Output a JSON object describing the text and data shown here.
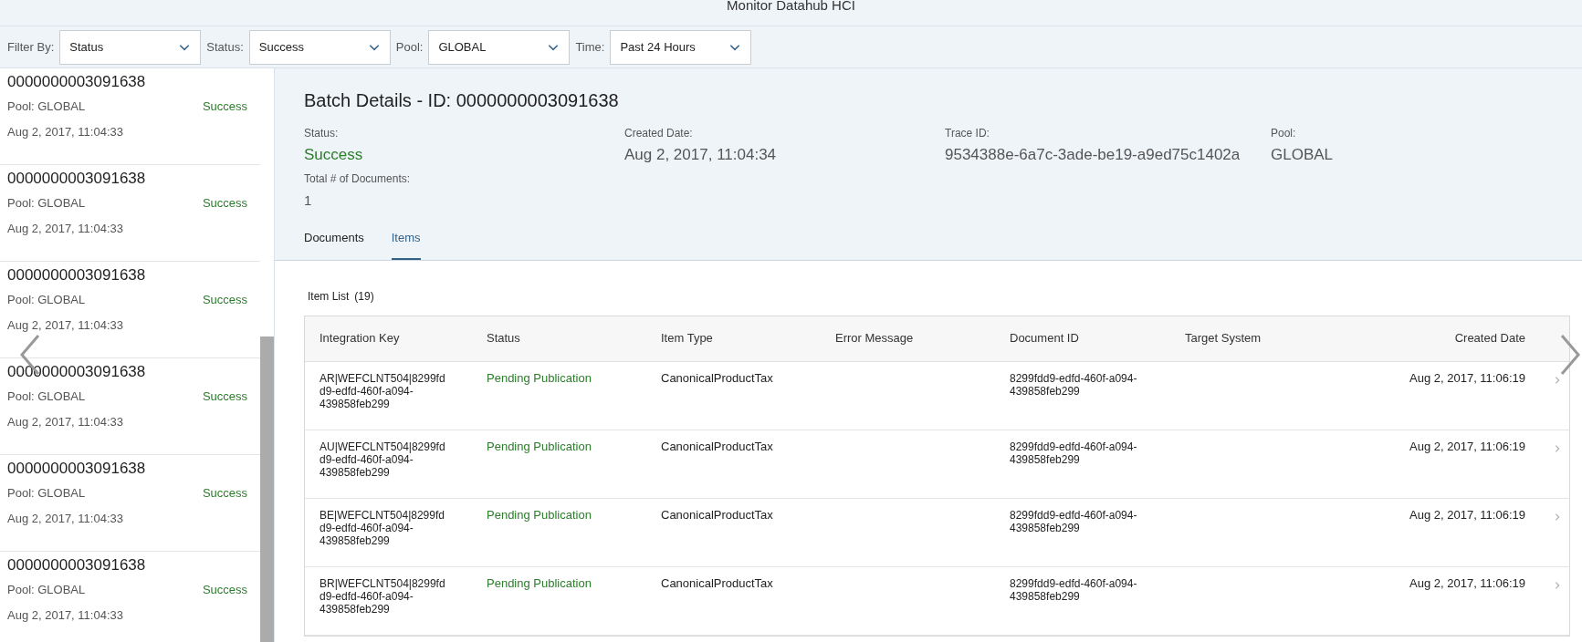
{
  "window": {
    "title": "Monitor Datahub HCI"
  },
  "filters": [
    {
      "label": "Filter By:",
      "value": "Status"
    },
    {
      "label": "Status:",
      "value": "Success"
    },
    {
      "label": "Pool:",
      "value": "GLOBAL"
    },
    {
      "label": "Time:",
      "value": "Past 24 Hours"
    }
  ],
  "batches": [
    {
      "id": "0000000003091638",
      "pool": "Pool: GLOBAL",
      "status": "Success",
      "date": "Aug 2, 2017, 11:04:33",
      "selected": false
    },
    {
      "id": "0000000003091638",
      "pool": "Pool: GLOBAL",
      "status": "Success",
      "date": "Aug 2, 2017, 11:04:33",
      "selected": false
    },
    {
      "id": "0000000003091638",
      "pool": "Pool: GLOBAL",
      "status": "Success",
      "date": "Aug 2, 2017, 11:04:33",
      "selected": false
    },
    {
      "id": "0000000003091638",
      "pool": "Pool: GLOBAL",
      "status": "Success",
      "date": "Aug 2, 2017, 11:04:33",
      "selected": false
    },
    {
      "id": "0000000003091638",
      "pool": "Pool: GLOBAL",
      "status": "Success",
      "date": "Aug 2, 2017, 11:04:33",
      "selected": false
    },
    {
      "id": "0000000003091638",
      "pool": "Pool: GLOBAL",
      "status": "Success",
      "date": "Aug 2, 2017, 11:04:33",
      "selected": false
    }
  ],
  "details": {
    "title": "Batch Details - ID: 0000000003091638",
    "fields": [
      {
        "label": "Status:",
        "value": "Success",
        "kind": "status"
      },
      {
        "label": "Created Date:",
        "value": "Aug 2, 2017, 11:04:34",
        "kind": "plain"
      },
      {
        "label": "Trace ID:",
        "value": "9534388e-6a7c-3ade-be19-a9ed75c1402a",
        "kind": "plain"
      },
      {
        "label": "Pool:",
        "value": "GLOBAL",
        "kind": "plain"
      }
    ],
    "documents_total": {
      "label": "Total # of Documents:",
      "value": "1"
    },
    "tabs": [
      {
        "label": "Documents",
        "selected": false
      },
      {
        "label": "Items",
        "selected": true
      }
    ]
  },
  "item_list": {
    "title": "Item List",
    "count": "(19)",
    "columns": [
      "Integration Key",
      "Status",
      "Item Type",
      "Error Message",
      "Document ID",
      "Target System",
      "Created Date"
    ],
    "rows": [
      {
        "key": "AR|WEFCLNT504|8299fdd9-edfd-460f-a094-439858feb299",
        "status": "Pending Publication",
        "type": "CanonicalProductTax",
        "document_id": "8299fdd9-edfd-460f-a094-439858feb299",
        "created": "Aug 2, 2017, 11:06:19"
      },
      {
        "key": "AU|WEFCLNT504|8299fdd9-edfd-460f-a094-439858feb299",
        "status": "Pending Publication",
        "type": "CanonicalProductTax",
        "document_id": "8299fdd9-edfd-460f-a094-439858feb299",
        "created": "Aug 2, 2017, 11:06:19"
      },
      {
        "key": "BE|WEFCLNT504|8299fdd9-edfd-460f-a094-439858feb299",
        "status": "Pending Publication",
        "type": "CanonicalProductTax",
        "document_id": "8299fdd9-edfd-460f-a094-439858feb299",
        "created": "Aug 2, 2017, 11:06:19"
      },
      {
        "key": "BR|WEFCLNT504|8299fdd9-edfd-460f-a094-439858feb299",
        "status": "Pending Publication",
        "type": "CanonicalProductTax",
        "document_id": "8299fdd9-edfd-460f-a094-439858feb299",
        "created": "Aug 2, 2017, 11:06:19"
      }
    ]
  }
}
